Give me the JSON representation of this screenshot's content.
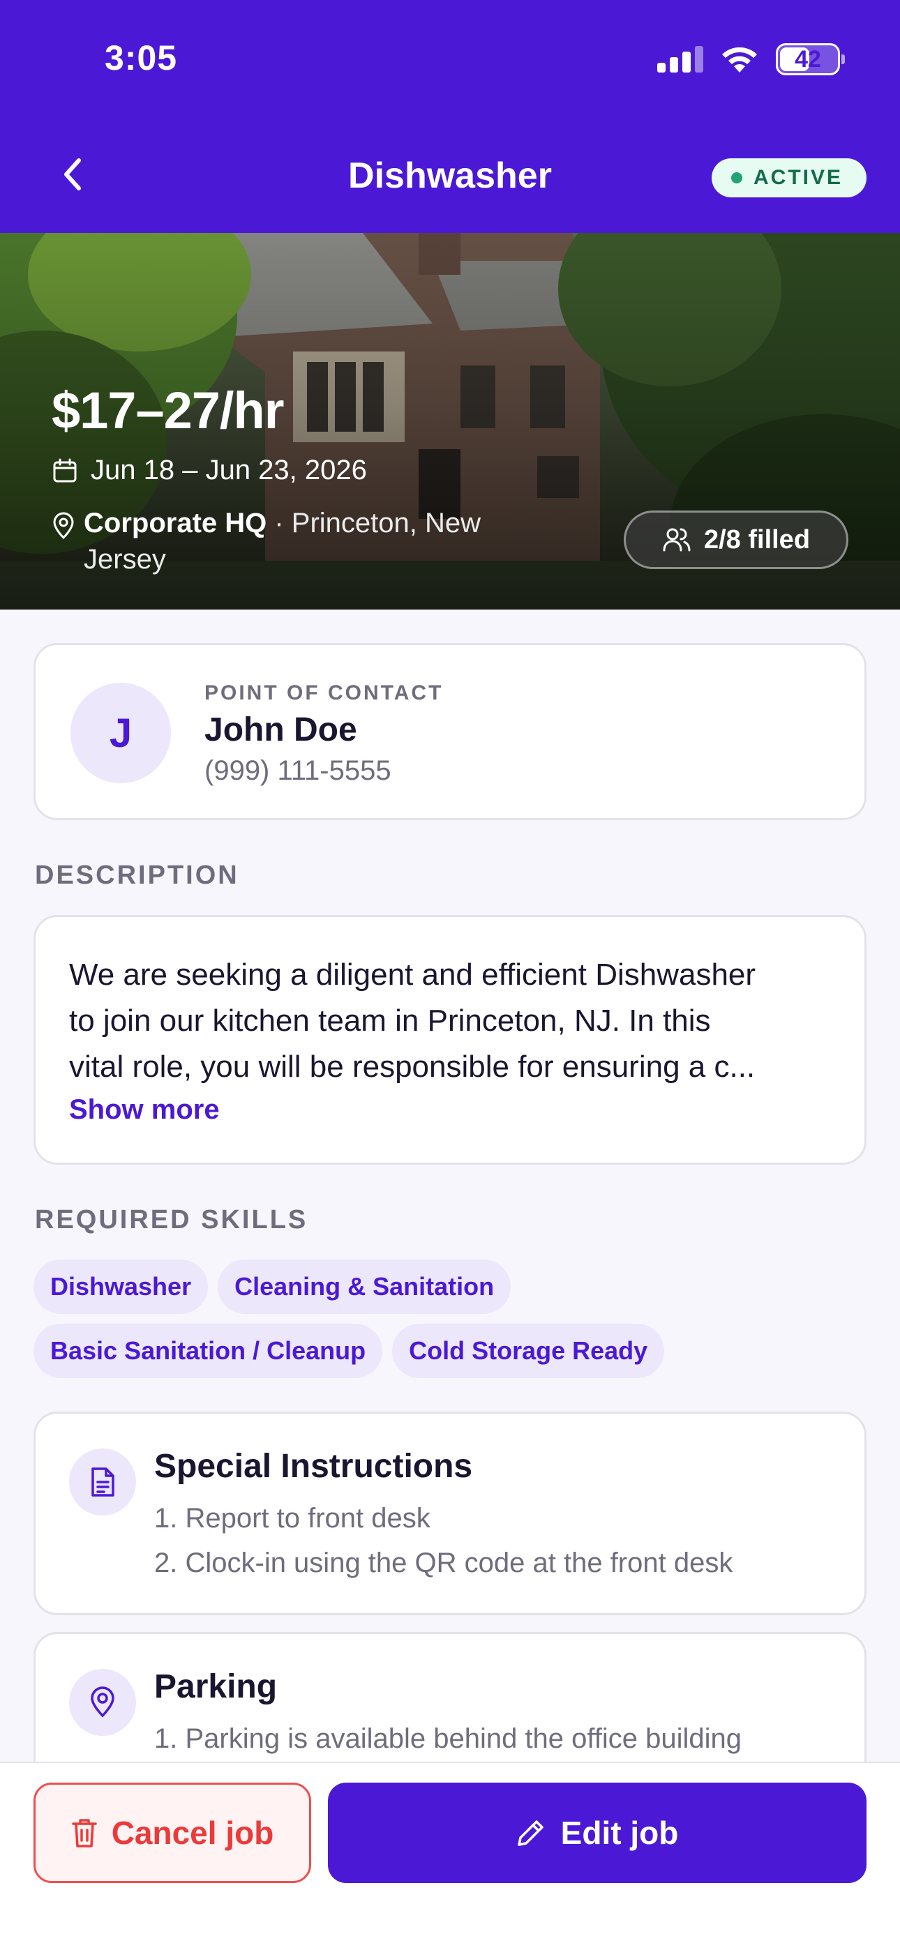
{
  "status_bar": {
    "time": "3:05",
    "battery": "42"
  },
  "nav": {
    "title": "Dishwasher",
    "status_badge": "ACTIVE"
  },
  "hero": {
    "pay": "$17–27/hr",
    "dates": "Jun 18 – Jun 23, 2026",
    "location_name": "Corporate HQ",
    "location_separator": " · ",
    "location_city": "Princeton, New Jersey",
    "filled": "2/8 filled"
  },
  "contact": {
    "label": "POINT OF CONTACT",
    "initial": "J",
    "name": "John Doe",
    "phone": "(999) 111-5555"
  },
  "description": {
    "label": "DESCRIPTION",
    "lines": [
      "We are seeking a diligent and efficient Dishwasher",
      "to join our kitchen team in Princeton, NJ. In this",
      "vital role, you will be responsible for ensuring a c..."
    ],
    "show_more": "Show more"
  },
  "skills": {
    "label": "REQUIRED SKILLS",
    "items": [
      "Dishwasher",
      "Cleaning & Sanitation",
      "Basic Sanitation / Cleanup",
      "Cold Storage Ready"
    ]
  },
  "special_instructions": {
    "title": "Special Instructions",
    "lines": [
      "1. Report to front desk",
      "2. Clock-in using the QR code at the front desk"
    ],
    "icon": "document-icon"
  },
  "parking": {
    "title": "Parking",
    "lines": [
      "1. Parking is available behind the office building"
    ],
    "icon": "map-pin-icon"
  },
  "actions": {
    "cancel": "Cancel job",
    "edit": "Edit job"
  },
  "colors": {
    "brand": "#4b19d6",
    "active_green": "#1fa472",
    "danger": "#ec3a3a"
  }
}
